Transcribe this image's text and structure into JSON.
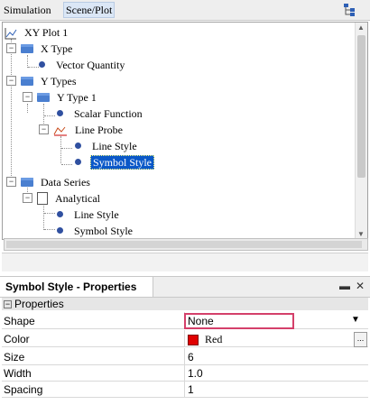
{
  "tabs": {
    "simulation": "Simulation",
    "scene_plot": "Scene/Plot"
  },
  "tree": {
    "root": "XY Plot 1",
    "x_type": "X Type",
    "vector_quantity": "Vector Quantity",
    "y_types": "Y Types",
    "y_type_1": "Y Type 1",
    "scalar_function": "Scalar Function",
    "line_probe": "Line Probe",
    "line_style_1": "Line Style",
    "symbol_style_1": "Symbol Style",
    "data_series": "Data Series",
    "analytical": "Analytical",
    "line_style_2": "Line Style",
    "symbol_style_2": "Symbol Style"
  },
  "properties": {
    "panel_title": "Symbol Style - Properties",
    "section": "Properties",
    "rows": [
      {
        "name": "Shape",
        "value": "None"
      },
      {
        "name": "Color",
        "value": "Red"
      },
      {
        "name": "Size",
        "value": "6"
      },
      {
        "name": "Width",
        "value": "1.0"
      },
      {
        "name": "Spacing",
        "value": "1"
      }
    ],
    "ellipsis": "...",
    "color_swatch": "#e00000"
  },
  "colors": {
    "selection": "#0a58c8",
    "highlight_border": "#d4406a"
  }
}
